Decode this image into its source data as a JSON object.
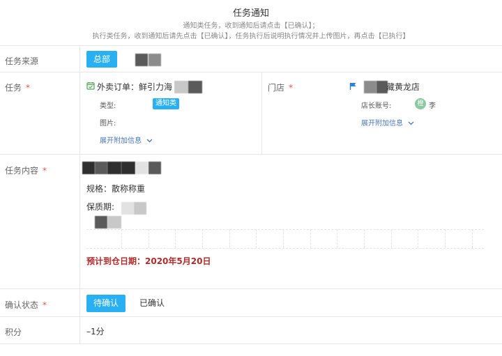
{
  "header": {
    "title": "任务通知",
    "note_line1": "通知类任务，收到通知后请点击【已确认】；",
    "note_line2": "执行类任务，收到通知后请先点击【已确认】，任务执行后说明执行情况并上传图片，再点击【已执行】"
  },
  "source": {
    "label": "任务来源",
    "button": "总部"
  },
  "task": {
    "label": "任务",
    "required": "*",
    "title": "外卖订单：鲜引力海",
    "type_label": "类型:",
    "type_value": "通知类",
    "image_label": "图片:",
    "expand_link": "展开附加信息"
  },
  "store": {
    "label": "门店",
    "required": "*",
    "name": "藏黄龙店",
    "manager_label": "店长账号:",
    "manager_avatar_char": "橙",
    "manager_name": "李",
    "expand_link": "展开附加信息"
  },
  "content": {
    "label": "任务内容",
    "required": "*",
    "spec": "规格：散称称重",
    "shelf_life": "保质期:",
    "arrival": "预计到仓日期：2020年5月20日"
  },
  "confirm": {
    "label": "确认状态",
    "required": "*",
    "pending": "待确认",
    "confirmed": "已确认"
  },
  "points": {
    "label": "积分",
    "value": "–1分"
  },
  "colors": {
    "primary": "#29b0f3",
    "required": "#e5534b",
    "link": "#4a77b4",
    "date_red": "#b22a2a"
  },
  "icons": {
    "calendar": "calendar-check-icon",
    "flag": "flag-icon",
    "chevron": "chevron-down-icon"
  }
}
